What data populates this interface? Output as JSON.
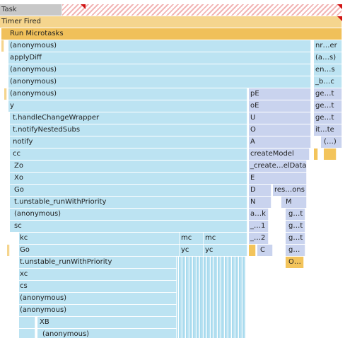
{
  "flame_chart": {
    "task_label": "Task",
    "timer_fired_label": "Timer Fired",
    "run_microtasks_label": "Run Microtasks",
    "main_stack": [
      "(anonymous)",
      "applyDiff",
      "(anonymous)",
      "(anonymous)",
      "(anonymous)",
      "y",
      "t.handleChangeWrapper",
      "t.notifyNestedSubs",
      "notify",
      "cc",
      "Zo",
      "Xo",
      "Go",
      "t.unstable_runWithPriority",
      "(anonymous)",
      "sc",
      "kc",
      "Go",
      "t.unstable_runWithPriority",
      "xc",
      "cs",
      "(anonymous)",
      "(anonymous)",
      "XB",
      "(anonymous)"
    ],
    "mid_frames": {
      "mc_1": "mc",
      "mc_2": "mc",
      "yc_1": "yc",
      "yc_2": "yc"
    },
    "right_stack": {
      "pE": "pE",
      "oE": "oE",
      "U": "U",
      "O": "O",
      "A": "A",
      "createModel": "createModel",
      "createData": "_create…elData",
      "E": "E",
      "D": "D",
      "resOns": "res…ons",
      "N": "N",
      "M": "M",
      "ak": "a…k",
      "gt_1": "g…t",
      "one": "_…1",
      "gt_2": "g…t",
      "two": "_…2",
      "gt_3": "g…t",
      "C": "C",
      "g": "g…",
      "O_ell": "O…"
    },
    "far_right": [
      "nr…er",
      "(a…s)",
      "en…s",
      "_b…c",
      "ge…t",
      "ge…t",
      "ge…t",
      "it…te",
      "(…)"
    ]
  }
}
